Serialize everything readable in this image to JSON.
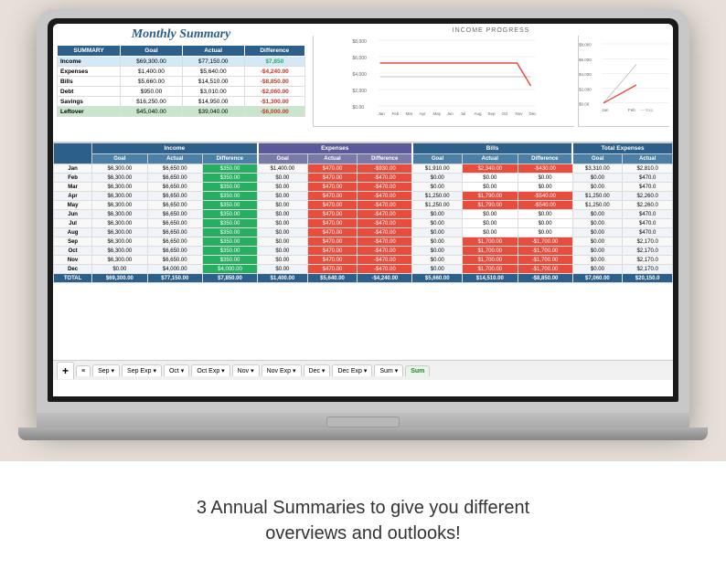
{
  "title": "Monthly Summary",
  "chart_title": "INCOME PROGRESS",
  "summary": {
    "header": [
      "SUMMARY",
      "Goal",
      "Actual",
      "Difference"
    ],
    "rows": [
      {
        "label": "Income",
        "goal": "$69,300.00",
        "actual": "$77,150.00",
        "diff": "$7,850",
        "diff_class": "pos"
      },
      {
        "label": "Expenses",
        "goal": "$1,400.00",
        "actual": "$5,640.00",
        "diff": "-$4,240.00",
        "diff_class": "neg"
      },
      {
        "label": "Bills",
        "goal": "$5,660.00",
        "actual": "$14,510.00",
        "diff": "-$8,850.00",
        "diff_class": "neg"
      },
      {
        "label": "Debt",
        "goal": "$950.00",
        "actual": "$3,010.00",
        "diff": "-$2,060.00",
        "diff_class": "neg"
      },
      {
        "label": "Savings",
        "goal": "$16,250.00",
        "actual": "$14,950.00",
        "diff": "-$1,300.00",
        "diff_class": "neg"
      },
      {
        "label": "Leftover",
        "goal": "$45,040.00",
        "actual": "$39,040.00",
        "diff": "-$6,000.00",
        "diff_class": "neg"
      }
    ]
  },
  "main_table": {
    "section_headers": [
      "Income",
      "",
      "",
      "Expenses",
      "",
      "",
      "Bills",
      "",
      "",
      "Total Expenses"
    ],
    "sub_headers": [
      "Goal",
      "Actual",
      "Difference",
      "Goal",
      "Actual",
      "Difference",
      "Goal",
      "Actual",
      "Difference",
      "Goal",
      "Actual"
    ],
    "rows": [
      {
        "month": "Jan",
        "inc_goal": "$6,300.00",
        "inc_act": "$6,650.00",
        "inc_diff": "$350.00",
        "exp_goal": "$1,400.00",
        "exp_act": "$470.00",
        "exp_diff": "-$930.00",
        "bill_goal": "$1,910.00",
        "bill_act": "$2,340.00",
        "bill_diff": "-$430.00",
        "tot_goal": "$3,310.00",
        "tot_act": "$2,810.0"
      },
      {
        "month": "Feb",
        "inc_goal": "$6,300.00",
        "inc_act": "$6,650.00",
        "inc_diff": "$350.00",
        "exp_goal": "$0.00",
        "exp_act": "$470.00",
        "exp_diff": "-$470.00",
        "bill_goal": "$0.00",
        "bill_act": "$0.00",
        "bill_diff": "$0.00",
        "tot_goal": "$0.00",
        "tot_act": "$470.0"
      },
      {
        "month": "Mar",
        "inc_goal": "$6,300.00",
        "inc_act": "$6,650.00",
        "inc_diff": "$350.00",
        "exp_goal": "$0.00",
        "exp_act": "$470.00",
        "exp_diff": "-$470.00",
        "bill_goal": "$0.00",
        "bill_act": "$0.00",
        "bill_diff": "$0.00",
        "tot_goal": "$0.00",
        "tot_act": "$470.0"
      },
      {
        "month": "Apr",
        "inc_goal": "$6,300.00",
        "inc_act": "$6,650.00",
        "inc_diff": "$350.00",
        "exp_goal": "$0.00",
        "exp_act": "$470.00",
        "exp_diff": "-$470.00",
        "bill_goal": "$1,250.00",
        "bill_act": "$1,790.00",
        "bill_diff": "-$540.00",
        "tot_goal": "$1,250.00",
        "tot_act": "$2,260.0"
      },
      {
        "month": "May",
        "inc_goal": "$6,300.00",
        "inc_act": "$6,650.00",
        "inc_diff": "$350.00",
        "exp_goal": "$0.00",
        "exp_act": "$470.00",
        "exp_diff": "-$470.00",
        "bill_goal": "$1,250.00",
        "bill_act": "$1,790.00",
        "bill_diff": "-$540.00",
        "tot_goal": "$1,250.00",
        "tot_act": "$2,260.0"
      },
      {
        "month": "Jun",
        "inc_goal": "$6,300.00",
        "inc_act": "$6,650.00",
        "inc_diff": "$350.00",
        "exp_goal": "$0.00",
        "exp_act": "$470.00",
        "exp_diff": "-$470.00",
        "bill_goal": "$0.00",
        "bill_act": "$0.00",
        "bill_diff": "$0.00",
        "tot_goal": "$0.00",
        "tot_act": "$470.0"
      },
      {
        "month": "Jul",
        "inc_goal": "$6,300.00",
        "inc_act": "$6,650.00",
        "inc_diff": "$350.00",
        "exp_goal": "$0.00",
        "exp_act": "$470.00",
        "exp_diff": "-$470.00",
        "bill_goal": "$0.00",
        "bill_act": "$0.00",
        "bill_diff": "$0.00",
        "tot_goal": "$0.00",
        "tot_act": "$470.0"
      },
      {
        "month": "Aug",
        "inc_goal": "$6,300.00",
        "inc_act": "$6,650.00",
        "inc_diff": "$350.00",
        "exp_goal": "$0.00",
        "exp_act": "$470.00",
        "exp_diff": "-$470.00",
        "bill_goal": "$0.00",
        "bill_act": "$0.00",
        "bill_diff": "$0.00",
        "tot_goal": "$0.00",
        "tot_act": "$470.0"
      },
      {
        "month": "Sep",
        "inc_goal": "$6,300.00",
        "inc_act": "$6,650.00",
        "inc_diff": "$350.00",
        "exp_goal": "$0.00",
        "exp_act": "$470.00",
        "exp_diff": "-$470.00",
        "bill_goal": "$0.00",
        "bill_act": "$1,700.00",
        "bill_diff": "-$1,700.00",
        "tot_goal": "$0.00",
        "tot_act": "$2,170.0"
      },
      {
        "month": "Oct",
        "inc_goal": "$6,300.00",
        "inc_act": "$6,650.00",
        "inc_diff": "$350.00",
        "exp_goal": "$0.00",
        "exp_act": "$470.00",
        "exp_diff": "-$470.00",
        "bill_goal": "$0.00",
        "bill_act": "$1,700.00",
        "bill_diff": "-$1,700.00",
        "tot_goal": "$0.00",
        "tot_act": "$2,170.0"
      },
      {
        "month": "Nov",
        "inc_goal": "$6,300.00",
        "inc_act": "$6,650.00",
        "inc_diff": "$350.00",
        "exp_goal": "$0.00",
        "exp_act": "$470.00",
        "exp_diff": "-$470.00",
        "bill_goal": "$0.00",
        "bill_act": "$1,700.00",
        "bill_diff": "-$1,700.00",
        "tot_goal": "$0.00",
        "tot_act": "$2,170.0"
      },
      {
        "month": "Dec",
        "inc_goal": "$0.00",
        "inc_act": "$4,000.00",
        "inc_diff": "$4,000.00",
        "exp_goal": "$0.00",
        "exp_act": "$470.00",
        "exp_diff": "-$470.00",
        "bill_goal": "$0.00",
        "bill_act": "$1,700.00",
        "bill_diff": "-$1,700.00",
        "tot_goal": "$0.00",
        "tot_act": "$2,170.0"
      },
      {
        "month": "TOTAL",
        "inc_goal": "$69,300.00",
        "inc_act": "$77,150.00",
        "inc_diff": "$7,850.00",
        "exp_goal": "$1,400.00",
        "exp_act": "$5,640.00",
        "exp_diff": "-$4,240.00",
        "bill_goal": "$5,660.00",
        "bill_act": "$14,510.00",
        "bill_diff": "-$8,850.00",
        "tot_goal": "$7,060.00",
        "tot_act": "$20,150.0"
      }
    ]
  },
  "tabs": [
    {
      "label": "+",
      "type": "add"
    },
    {
      "label": "≡",
      "type": "list"
    },
    {
      "label": "Sep ▾",
      "type": "normal"
    },
    {
      "label": "Sep Exp ▾",
      "type": "normal"
    },
    {
      "label": "Oct ▾",
      "type": "normal"
    },
    {
      "label": "Oct Exp ▾",
      "type": "normal"
    },
    {
      "label": "Nov ▾",
      "type": "normal"
    },
    {
      "label": "Nov Exp ▾",
      "type": "normal"
    },
    {
      "label": "Dec ▾",
      "type": "normal"
    },
    {
      "label": "Dec Exp ▾",
      "type": "normal"
    },
    {
      "label": "Sum ▾",
      "type": "normal"
    },
    {
      "label": "Sum",
      "type": "sum"
    }
  ],
  "caption": "3 Annual Summaries to give you different\noverviews and outlooks!"
}
